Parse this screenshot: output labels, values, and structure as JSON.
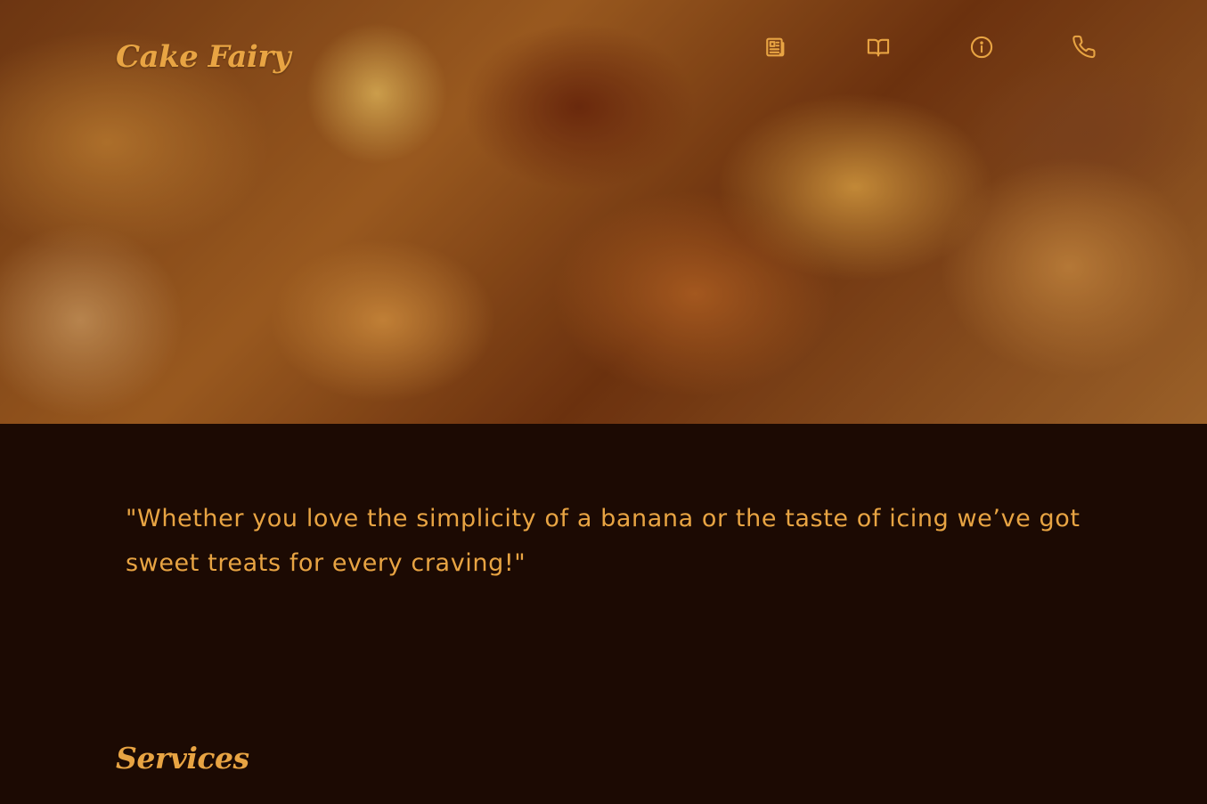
{
  "brand": {
    "name": "Cake Fairy"
  },
  "nav": {
    "items": [
      {
        "icon": "newspaper-icon"
      },
      {
        "icon": "book-icon"
      },
      {
        "icon": "info-icon"
      },
      {
        "icon": "phone-icon"
      }
    ]
  },
  "intro": {
    "quote": "\"Whether you love the simplicity of a banana or the taste of icing we’ve got sweet treats for every craving!\""
  },
  "services": {
    "title": "Services"
  },
  "colors": {
    "accent": "#e8a443",
    "background": "#1c0a03"
  }
}
